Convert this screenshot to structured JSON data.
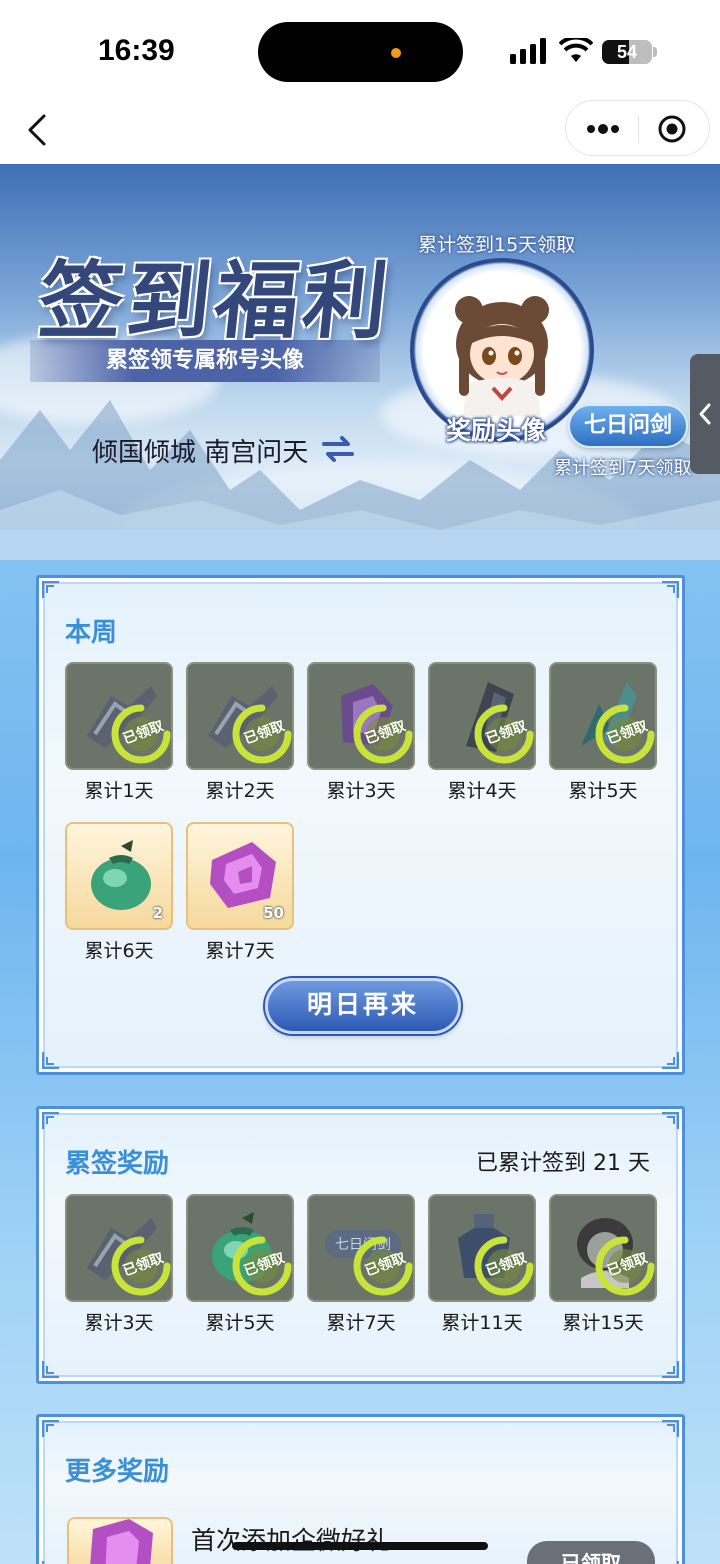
{
  "status_bar": {
    "time": "16:39",
    "battery": "54",
    "battery_level": 0.54
  },
  "banner": {
    "title": "签到福利",
    "subtitle": "累签领专属称号头像",
    "player_name": "倾国倾城 南宫问天",
    "avatar_caption_top": "累计签到15天领取",
    "avatar_label": "奖励头像",
    "title_badge": "七日问剑",
    "title_badge_caption": "累计签到7天领取"
  },
  "weekly": {
    "title": "本周",
    "items": [
      {
        "label": "累计1天",
        "status": "已领取",
        "claimed": true,
        "icon": "sword-fragment-icon"
      },
      {
        "label": "累计2天",
        "status": "已领取",
        "claimed": true,
        "icon": "sword-fragment-icon"
      },
      {
        "label": "累计3天",
        "status": "已领取",
        "claimed": true,
        "icon": "purple-crystal-icon"
      },
      {
        "label": "累计4天",
        "status": "已领取",
        "claimed": true,
        "icon": "dark-crystal-icon"
      },
      {
        "label": "累计5天",
        "status": "已领取",
        "claimed": true,
        "icon": "jade-crystal-icon"
      },
      {
        "label": "累计6天",
        "count": "2",
        "claimed": false,
        "icon": "green-pouch-icon"
      },
      {
        "label": "累计7天",
        "count": "50",
        "claimed": false,
        "icon": "purple-gem-icon"
      }
    ],
    "button": "明日再来"
  },
  "cumulative": {
    "title": "累签奖励",
    "summary": "已累计签到 21 天",
    "items": [
      {
        "label": "累计3天",
        "status": "已领取",
        "claimed": true,
        "icon": "sword-fragment-icon"
      },
      {
        "label": "累计5天",
        "status": "已领取",
        "claimed": true,
        "icon": "green-pouch-icon"
      },
      {
        "label": "累计7天",
        "status": "已领取",
        "claimed": true,
        "icon": "title-badge-icon",
        "art_text": "七日问剑"
      },
      {
        "label": "累计11天",
        "status": "已领取",
        "claimed": true,
        "icon": "armor-icon"
      },
      {
        "label": "累计15天",
        "status": "已领取",
        "claimed": true,
        "icon": "avatar-icon"
      }
    ]
  },
  "more": {
    "title": "更多奖励",
    "item_text": "首次添加企微好礼",
    "item_button": "已领取"
  },
  "colors": {
    "accent": "#3a8fd6",
    "card_border": "#4d8fd8",
    "button": "#2d59b5"
  }
}
